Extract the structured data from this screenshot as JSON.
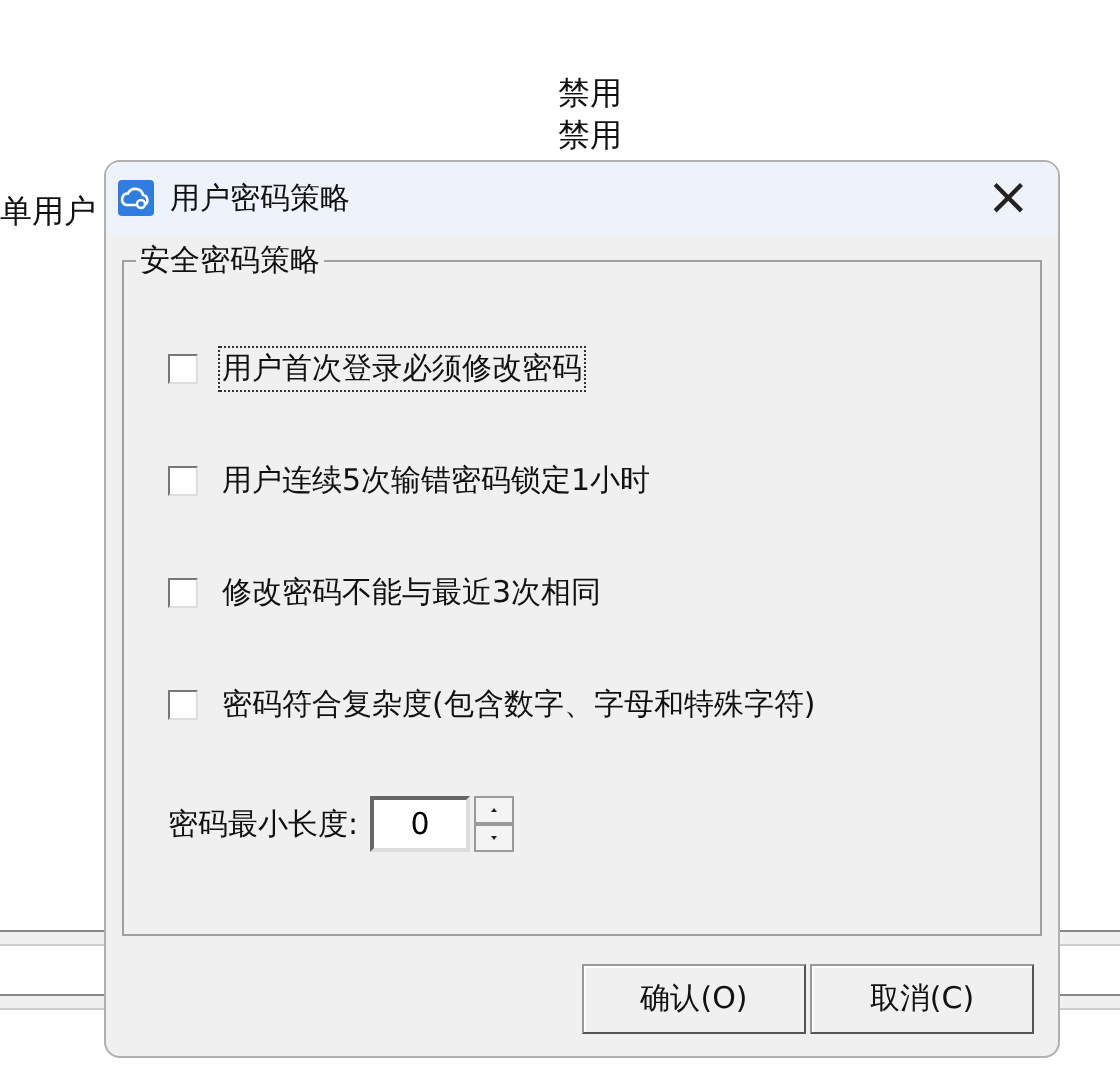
{
  "background": {
    "status_labels": [
      "禁用",
      "禁用"
    ],
    "row_label": "单用户"
  },
  "dialog": {
    "title": "用户密码策略",
    "close": "×",
    "group": {
      "title": "安全密码策略",
      "options": [
        {
          "label": "用户首次登录必须修改密码",
          "checked": false,
          "focused": true
        },
        {
          "label": "用户连续5次输错密码锁定1小时",
          "checked": false,
          "focused": false
        },
        {
          "label": "修改密码不能与最近3次相同",
          "checked": false,
          "focused": false
        },
        {
          "label": "密码符合复杂度(包含数字、字母和特殊字符)",
          "checked": false,
          "focused": false
        }
      ],
      "min_length": {
        "label": "密码最小长度:",
        "value": "0"
      }
    },
    "buttons": [
      {
        "label": "确认(O)"
      },
      {
        "label": "取消(C)"
      }
    ]
  }
}
